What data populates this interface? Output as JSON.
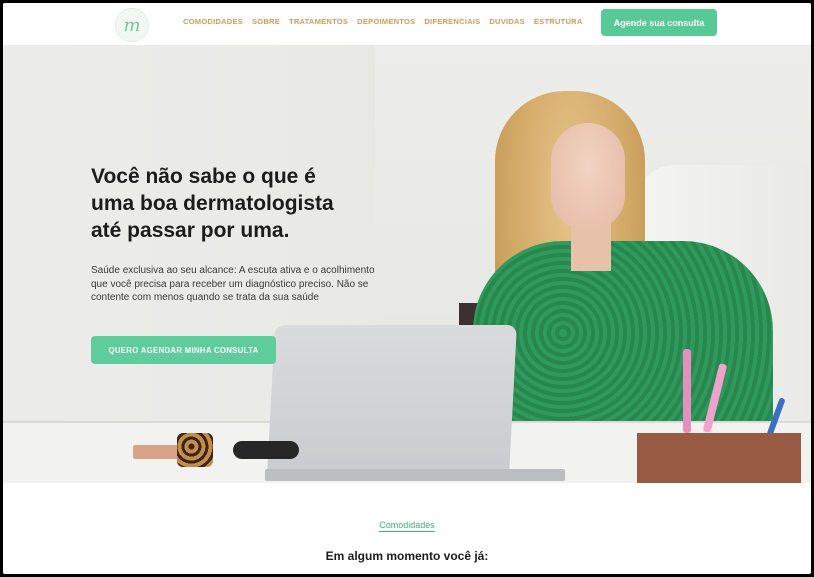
{
  "header": {
    "logo_letter": "m",
    "nav": [
      "COMODIDADES",
      "SOBRE",
      "TRATAMENTOS",
      "DEPOIMENTOS",
      "DIFERENCIAIS",
      "DUVIDAS",
      "ESTRUTURA"
    ],
    "cta_label": "Agende sua consulta"
  },
  "hero": {
    "headline_lines": [
      "Você não sabe o que é",
      "uma boa dermatologista",
      "até passar por uma."
    ],
    "subtitle": "Saúde exclusiva ao seu alcance: A escuta ativa e o acolhimento que você precisa para receber um diagnóstico preciso. Não se contente com menos quando se trata da sua saúde",
    "cta_label": "QUERO AGENDAR MINHA CONSULTA"
  },
  "next_section": {
    "tag": "Comodidades",
    "title": "Em algum momento você já:"
  },
  "colors": {
    "accent_green": "#56c996",
    "nav_gold": "#d49a5d",
    "text_dark": "#1c1c1c"
  }
}
